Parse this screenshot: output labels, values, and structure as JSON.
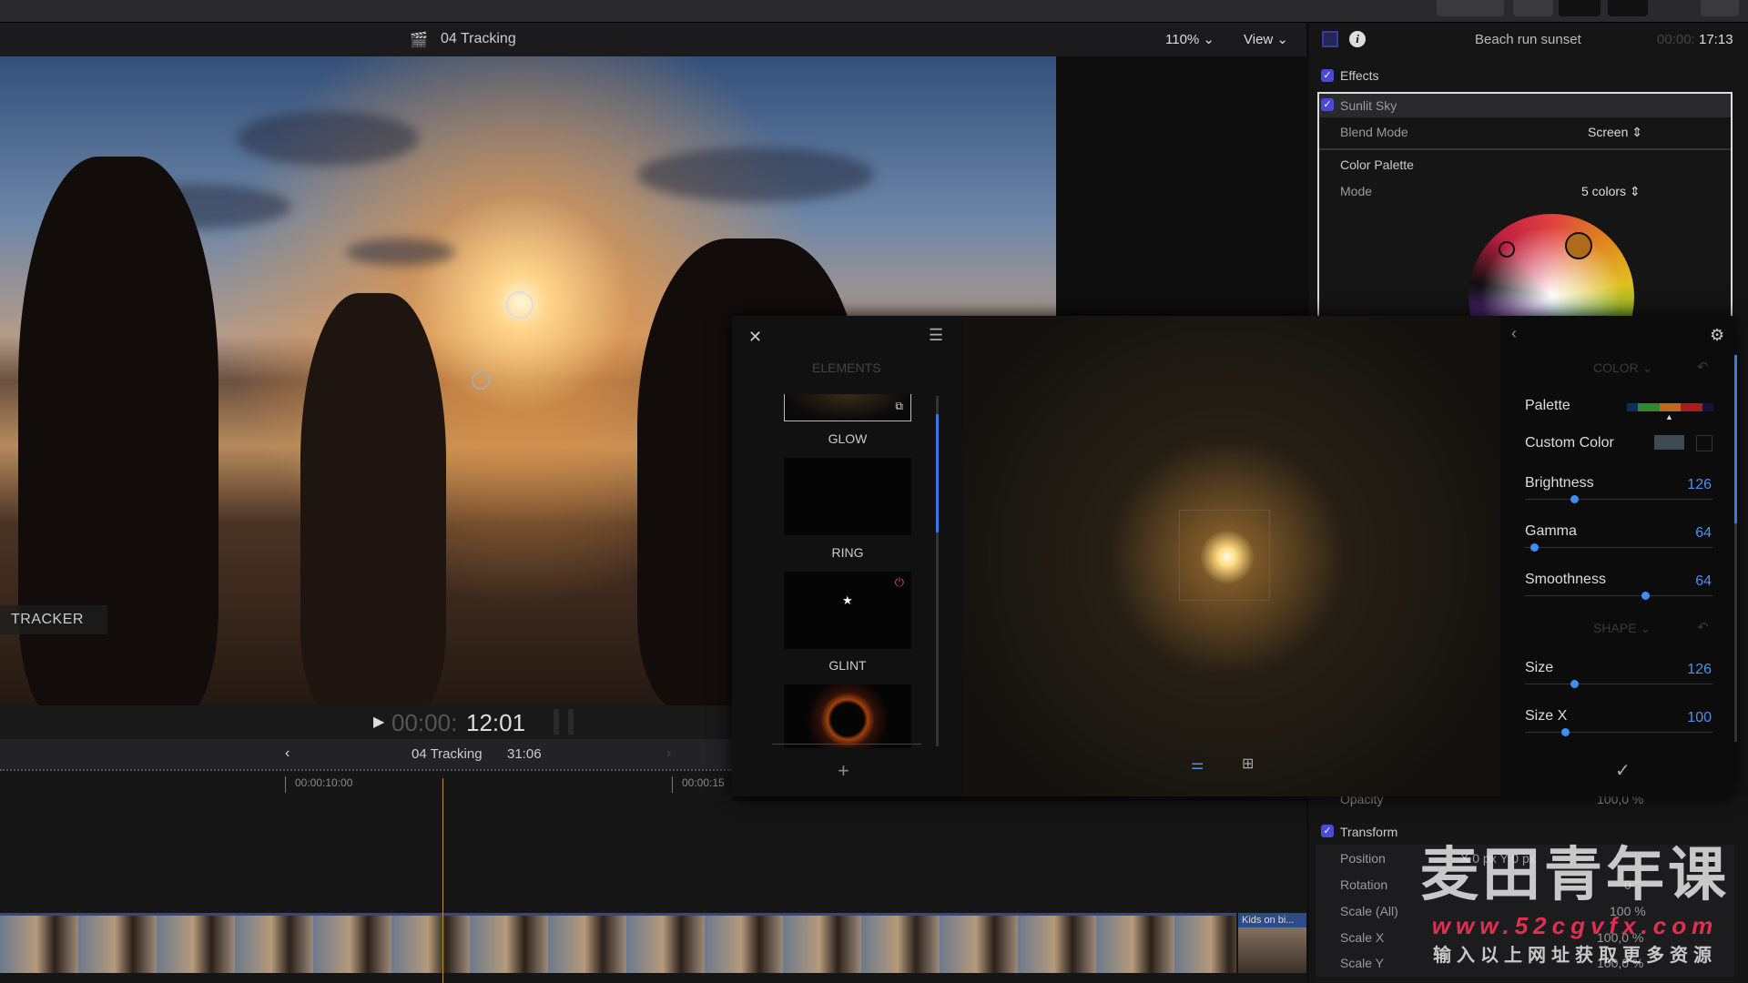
{
  "viewer": {
    "title": "04 Tracking",
    "zoom": "110%",
    "view_label": "View",
    "tracker_label": "TRACKER",
    "timecode_dim": "00:00:",
    "timecode": "12:01"
  },
  "timeline": {
    "project": "04 Tracking",
    "duration": "31:06",
    "ruler": [
      "00:00:10:00",
      "00:00:15"
    ],
    "clip_name": "Kids on bi..."
  },
  "inspector": {
    "clip_title": "Beach run sunset",
    "timecode_dim": "00:00:",
    "timecode": "17:13",
    "effects_label": "Effects",
    "effect_name": "Sunlit Sky",
    "blend_mode_label": "Blend Mode",
    "blend_mode": "Screen",
    "palette_label": "Color Palette",
    "mode_label": "Mode",
    "mode": "5 colors",
    "opacity_label": "Opacity",
    "opacity": "100,0 %",
    "transform_label": "Transform",
    "transform_rows": [
      {
        "label": "Position",
        "value": "X   0 px   Y   0 px"
      },
      {
        "label": "Rotation",
        "value": "0 °"
      },
      {
        "label": "Scale (All)",
        "value": "100 %"
      },
      {
        "label": "Scale X",
        "value": "100,0 %"
      },
      {
        "label": "Scale Y",
        "value": "100,0 %"
      }
    ]
  },
  "plugin": {
    "elements_title": "ELEMENTS",
    "elements": [
      {
        "label": "GLOW"
      },
      {
        "label": "RING"
      },
      {
        "label": "GLINT"
      }
    ],
    "add_label": "+",
    "color_section": "COLOR",
    "shape_section": "SHAPE",
    "palette_label": "Palette",
    "palette_colors": [
      "#0b2f5c",
      "#2d8a2d",
      "#c0681c",
      "#a81c1c",
      "#1a1040"
    ],
    "custom_color_label": "Custom Color",
    "custom_color": "#3c4a52",
    "sliders": [
      {
        "label": "Brightness",
        "value": "126",
        "fraction": 0.25
      },
      {
        "label": "Gamma",
        "value": "64",
        "fraction": 0.03
      },
      {
        "label": "Smoothness",
        "value": "64",
        "fraction": 0.64
      },
      {
        "label": "Size",
        "value": "126",
        "fraction": 0.25
      },
      {
        "label": "Size X",
        "value": "100",
        "fraction": 0.2
      }
    ]
  },
  "watermark": {
    "title": "麦田青年课",
    "url": "www.52cgvfx.com",
    "subtitle": "输入以上网址获取更多资源"
  }
}
